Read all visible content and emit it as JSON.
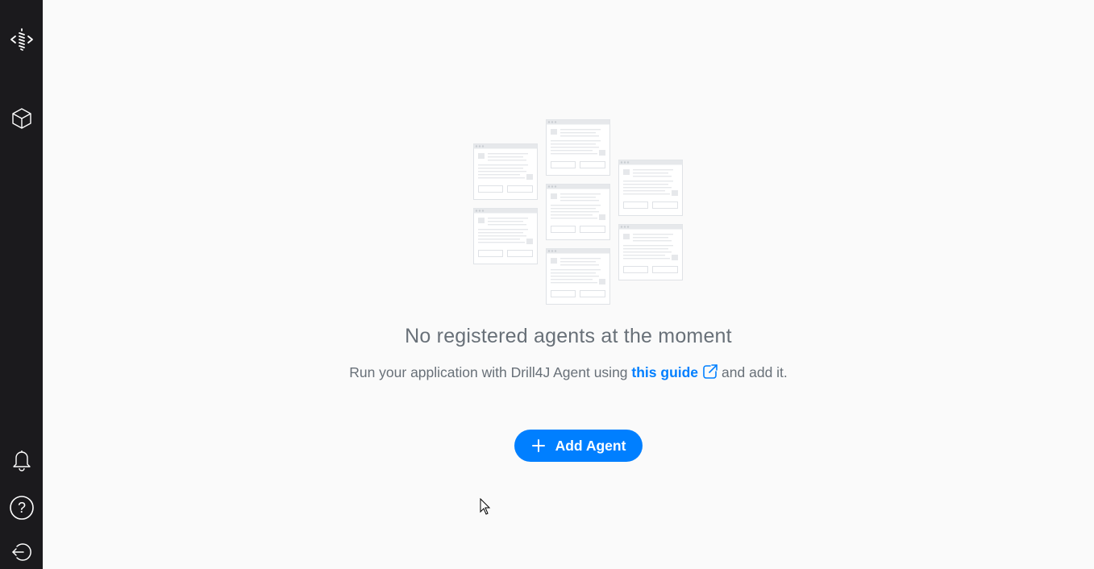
{
  "sidebar": {
    "top_items": [
      {
        "icon": "drill4j-logo-icon"
      },
      {
        "icon": "agents-cube-icon"
      }
    ],
    "bottom_items": [
      {
        "icon": "bell-icon"
      },
      {
        "icon": "help-circle-icon"
      },
      {
        "icon": "logout-icon"
      }
    ],
    "background": "#1b1a1d"
  },
  "empty_state": {
    "title": "No registered agents at the moment",
    "subtitle_prefix": "Run your application with Drill4J Agent using",
    "link_text": "this guide",
    "subtitle_suffix": "and add it.",
    "link_icon": "external-link-icon"
  },
  "add_button": {
    "label": "Add Agent",
    "icon": "plus-icon"
  },
  "colors": {
    "accent": "#007fff",
    "text_muted": "#687078",
    "background": "#fafafa"
  }
}
